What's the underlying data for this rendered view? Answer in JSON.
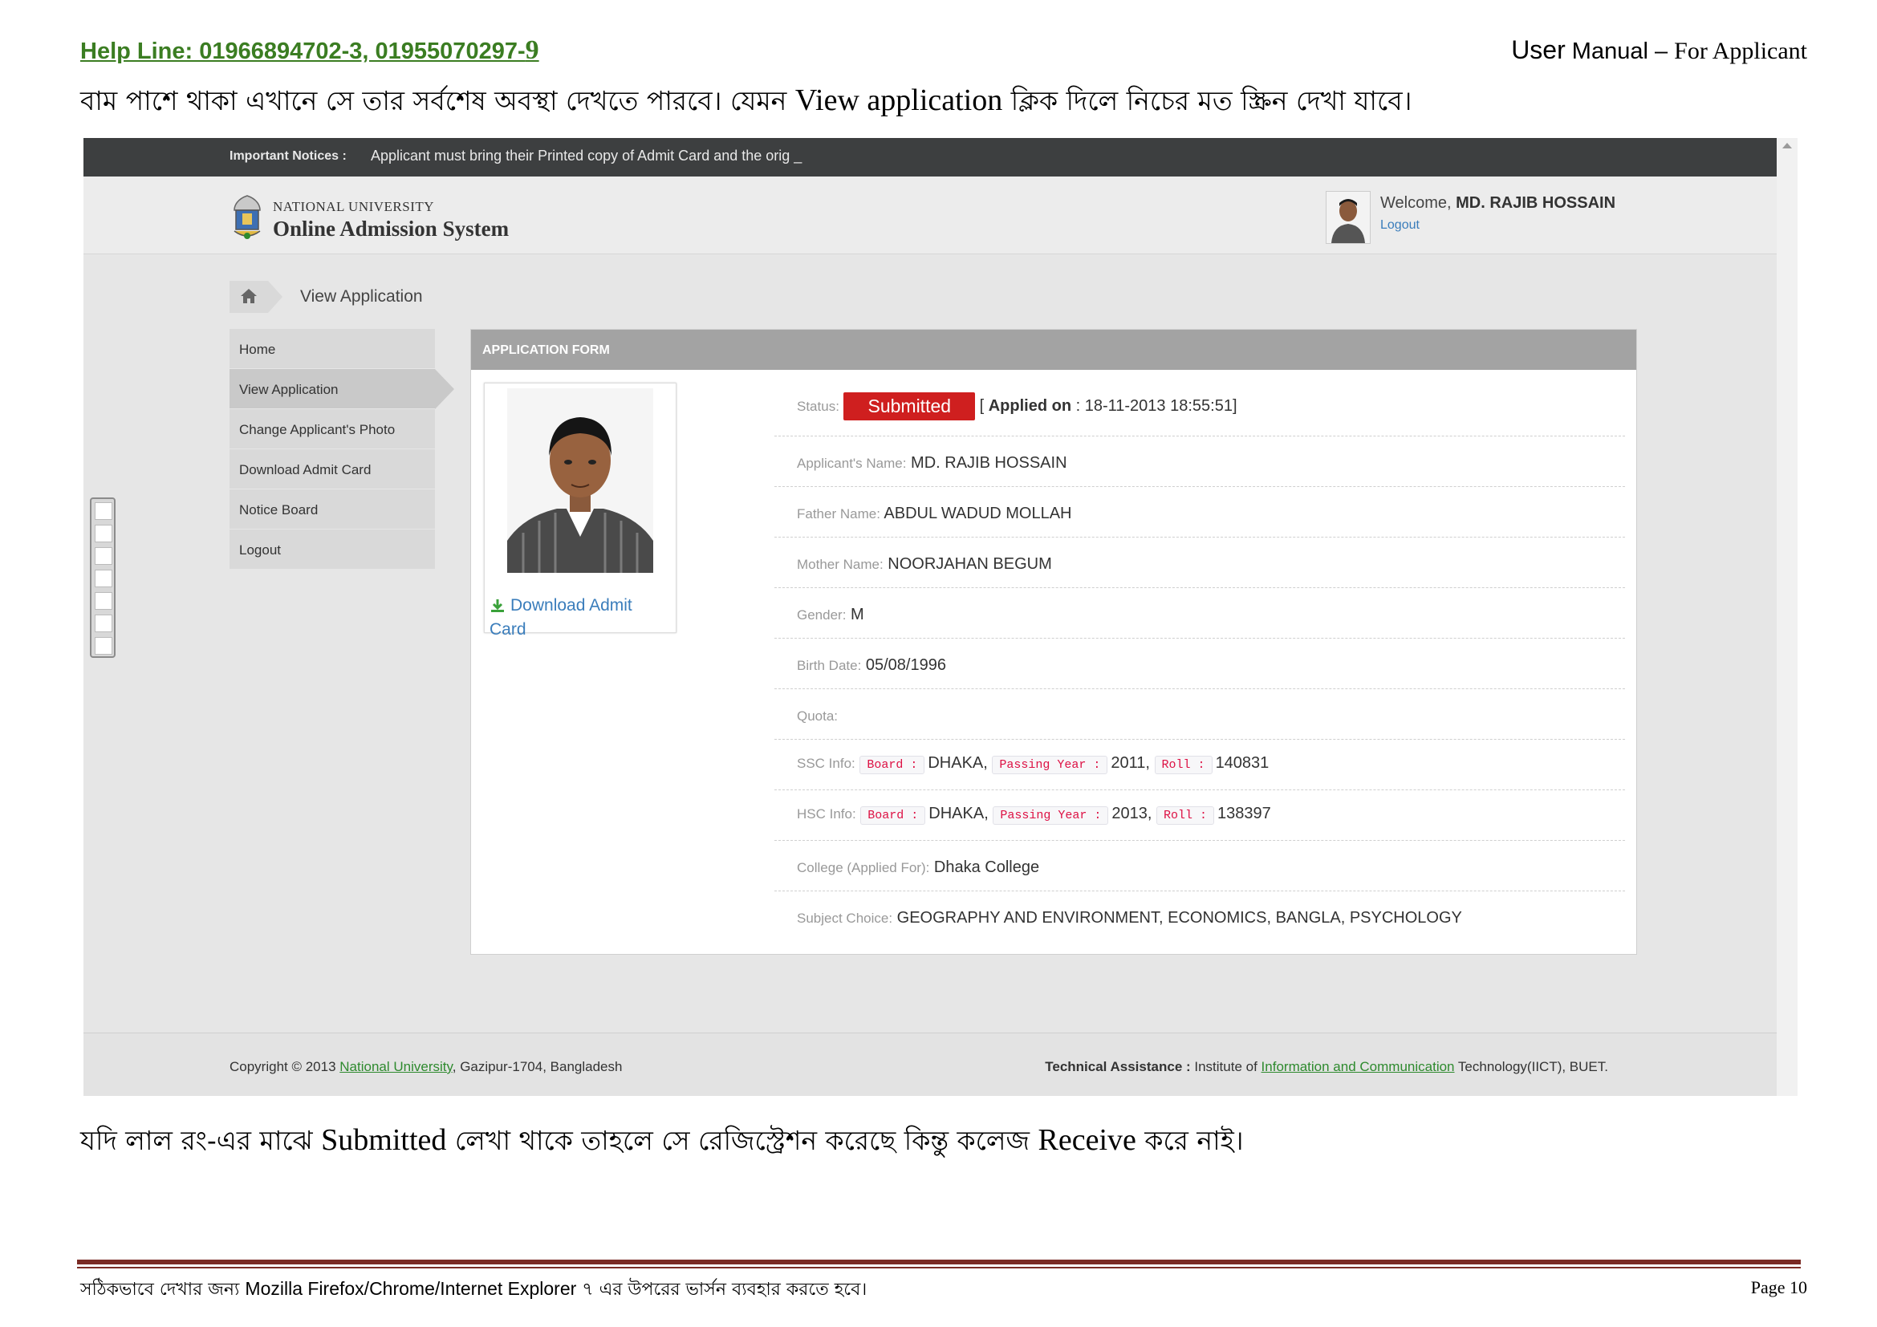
{
  "doc": {
    "helpline": "Help Line: 01966894702-3, 01955070297-",
    "helpline_last": "9",
    "manual_user": "User",
    "manual_rest": " Manual – ",
    "manual_for": "For Applicant",
    "intro_bn_1": "বাম পাশে থাকা এখানে সে তার সর্বশেষ অবস্থা দেখতে পারবে। যেমন ",
    "intro_en": "View application",
    "intro_bn_2": " ক্লিক দিলে নিচের মত স্ক্রিন দেখা যাবে।",
    "note_bn_1": "যদি লাল রং-এর মাঝে ",
    "note_en_1": "Submitted",
    "note_bn_2": " লেখা থাকে তাহলে সে রেজিস্ট্রেশন করেছে কিন্তু কলেজ ",
    "note_en_2": "Receive",
    "note_bn_3": " করে নাই।",
    "footer_bn_1": "সঠিকভাবে দেখার জন্য  ",
    "footer_en": "Mozilla Firefox/Chrome/Internet Explorer",
    "footer_bn_2": " ৭ এর উপরের ভার্সন ব্যবহার করতে হবে।",
    "page": "Page 10"
  },
  "site": {
    "notice_label": "Important Notices :",
    "notice_text": "Applicant must bring their Printed copy of Admit Card and the orig _",
    "univ_small": "NATIONAL UNIVERSITY",
    "univ_big": "Online Admission System",
    "welcome_prefix": "Welcome, ",
    "welcome_name": "MD. RAJIB HOSSAIN",
    "logout": "Logout",
    "breadcrumb": "View Application",
    "sidebar": [
      {
        "label": "Home"
      },
      {
        "label": "View Application"
      },
      {
        "label": "Change Applicant's Photo"
      },
      {
        "label": "Download Admit Card"
      },
      {
        "label": "Notice Board"
      },
      {
        "label": "Logout"
      }
    ],
    "panel_title": "APPLICATION FORM",
    "download_admit": "Download Admit Card",
    "status_label": "Status:",
    "status_value": "Submitted",
    "applied_prefix": "[ ",
    "applied_label": "Applied on",
    "applied_value": " : 18-11-2013 18:55:51]",
    "name_label": "Applicant's Name:",
    "name_value": "MD. RAJIB HOSSAIN",
    "father_label": "Father Name:",
    "father_value": "ABDUL WADUD MOLLAH",
    "mother_label": "Mother Name:",
    "mother_value": "NOORJAHAN BEGUM",
    "gender_label": "Gender:",
    "gender_value": "M",
    "birth_label": "Birth Date:",
    "birth_value": "05/08/1996",
    "quota_label": "Quota:",
    "ssc_label": "SSC Info:",
    "hsc_label": "HSC Info:",
    "board_tag": "Board :",
    "passing_tag": "Passing Year :",
    "roll_tag": "Roll :",
    "ssc_board": "DHAKA,",
    "ssc_year": "2011,",
    "ssc_roll": "140831",
    "hsc_board": "DHAKA,",
    "hsc_year": "2013,",
    "hsc_roll": "138397",
    "college_label": "College (Applied For):",
    "college_value": "Dhaka College",
    "subject_label": "Subject Choice:",
    "subject_value": "GEOGRAPHY AND ENVIRONMENT, ECONOMICS, BANGLA, PSYCHOLOGY",
    "copyright_1": "Copyright © 2013 ",
    "copyright_link": "National University",
    "copyright_2": ", Gazipur-1704, Bangladesh",
    "tech_label": "Technical Assistance :",
    "tech_1": " Institute of ",
    "tech_link": "Information and Communication",
    "tech_2": " Technology(IICT), BUET."
  },
  "colors": {
    "helpline": "#3b7d22",
    "status_badge": "#cf1f1f",
    "link": "#3a7dbb",
    "footer_rule": "#7a2a24"
  }
}
